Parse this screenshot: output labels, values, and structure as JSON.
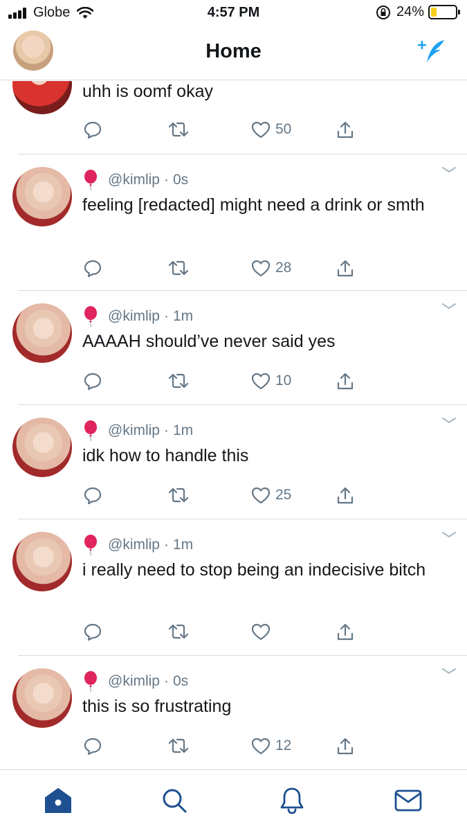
{
  "status_bar": {
    "carrier": "Globe",
    "time": "4:57 PM",
    "battery": "24%",
    "battery_level": 0.24
  },
  "header": {
    "title": "Home"
  },
  "colors": {
    "accent": "#1da1f2",
    "nav_active": "#1d4f91",
    "meta_gray": "#657786",
    "divider": "#d6dbe0",
    "balloon": "#e0245e"
  },
  "tweets": [
    {
      "handle": "",
      "time": "",
      "text": "uhh is oomf okay",
      "likes": "50"
    },
    {
      "handle": "@kimlip",
      "time": "0s",
      "text": "feeling [redacted] might need a drink or smth",
      "likes": "28"
    },
    {
      "handle": "@kimlip",
      "time": "1m",
      "text": "AAAAH should’ve never said yes",
      "likes": "10"
    },
    {
      "handle": "@kimlip",
      "time": "1m",
      "text": "idk how to handle this",
      "likes": "25"
    },
    {
      "handle": "@kimlip",
      "time": "1m",
      "text": "i really need to stop being an indecisive bitch",
      "likes": ""
    },
    {
      "handle": "@kimlip",
      "time": "0s",
      "text": "this is so frustrating",
      "likes": "12"
    }
  ],
  "tabbar": {
    "items": [
      "home-icon",
      "search-icon",
      "notifications-icon",
      "messages-icon"
    ]
  }
}
